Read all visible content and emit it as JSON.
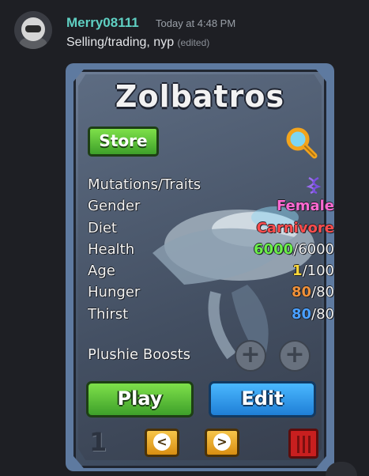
{
  "message": {
    "username": "Merry08111",
    "timestamp": "Today at 4:48 PM",
    "text": "Selling/trading, nyp",
    "edited": "(edited)"
  },
  "card": {
    "title": "Zolbatros",
    "store_label": "Store",
    "stats": [
      {
        "label": "Mutations/Traits"
      },
      {
        "label": "Gender",
        "value": "Female"
      },
      {
        "label": "Diet",
        "value": "Carnivore"
      },
      {
        "label": "Health",
        "current": "6000",
        "max": "/6000"
      },
      {
        "label": "Age",
        "current": "1",
        "max": "/100"
      },
      {
        "label": "Hunger",
        "current": "80",
        "max": "/80"
      },
      {
        "label": "Thirst",
        "current": "80",
        "max": "/80"
      }
    ],
    "plushie_label": "Plushie Boosts",
    "play_label": "Play",
    "edit_label": "Edit",
    "page_number": "1",
    "prev_symbol": "<",
    "next_symbol": ">",
    "plus_symbol": "+",
    "colors": {
      "female": "#ff6ad2",
      "carnivore": "#ff4d4d",
      "health": "#6cf04a",
      "age": "#ffd83a",
      "hunger": "#f0913a",
      "thirst": "#4aa0ff"
    }
  }
}
